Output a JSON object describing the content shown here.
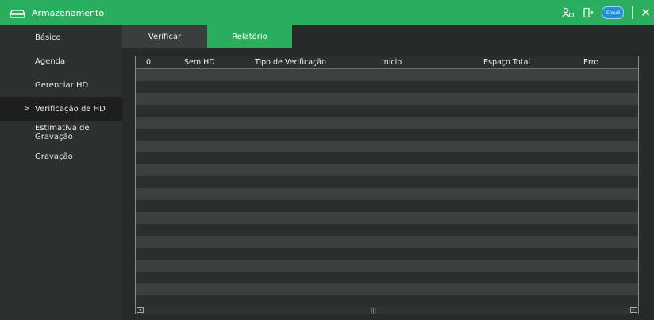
{
  "title": {
    "app_title": "Armazenamento",
    "cloud_label": "Cloud"
  },
  "sidebar": {
    "items": [
      {
        "label": "Básico"
      },
      {
        "label": "Agenda"
      },
      {
        "label": "Gerenciar HD"
      },
      {
        "label": "Verificação de HD",
        "active": true
      },
      {
        "label": "Estimativa de Gravação"
      },
      {
        "label": "Gravação"
      }
    ],
    "active_marker": ">"
  },
  "tabs": [
    {
      "label": "Verificar"
    },
    {
      "label": "Relatório",
      "active": true
    }
  ],
  "table": {
    "headers": [
      "0",
      "Sem HD",
      "Tipo de Verificação",
      "Início",
      "Espaço Total",
      "Erro"
    ]
  },
  "colors": {
    "accent": "#2bad5e",
    "background": "#262a28",
    "row_alt": "#3c403e"
  },
  "icons": [
    "storage-icon",
    "user-cloud-icon",
    "logout-icon",
    "cloud-icon",
    "close-icon"
  ]
}
